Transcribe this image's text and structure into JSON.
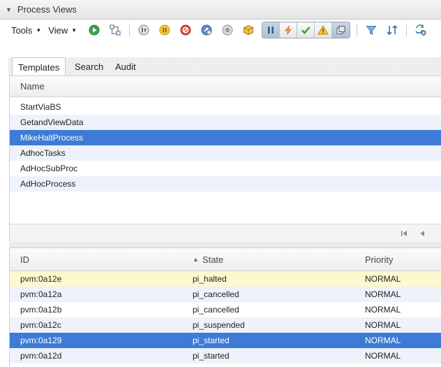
{
  "panel": {
    "title": "Process Views"
  },
  "toolbar": {
    "tools_label": "Tools",
    "view_label": "View"
  },
  "tabs": [
    {
      "label": "Templates",
      "active": true
    },
    {
      "label": "Search",
      "active": false
    },
    {
      "label": "Audit",
      "active": false
    }
  ],
  "templates": {
    "column_name": "Name",
    "rows": [
      "StartViaBS",
      "GetandViewData",
      "MikeHaltProcess",
      "AdhocTasks",
      "AdHocSubProc",
      "AdHocProcess"
    ],
    "selected_index": 2
  },
  "instances": {
    "columns": {
      "id": "ID",
      "state": "State",
      "priority": "Priority"
    },
    "sort_column": "state",
    "rows": [
      {
        "id": "pvm:0a12e",
        "state": "pi_halted",
        "priority": "NORMAL",
        "highlight": true
      },
      {
        "id": "pvm:0a12a",
        "state": "pi_cancelled",
        "priority": "NORMAL"
      },
      {
        "id": "pvm:0a12b",
        "state": "pi_cancelled",
        "priority": "NORMAL"
      },
      {
        "id": "pvm:0a12c",
        "state": "pi_suspended",
        "priority": "NORMAL"
      },
      {
        "id": "pvm:0a129",
        "state": "pi_started",
        "priority": "NORMAL",
        "selected": true
      },
      {
        "id": "pvm:0a12d",
        "state": "pi_started",
        "priority": "NORMAL"
      }
    ]
  },
  "colors": {
    "selection": "#3d7bd7",
    "alt_row": "#edf2fb",
    "highlight_row": "#fcf9cf"
  }
}
